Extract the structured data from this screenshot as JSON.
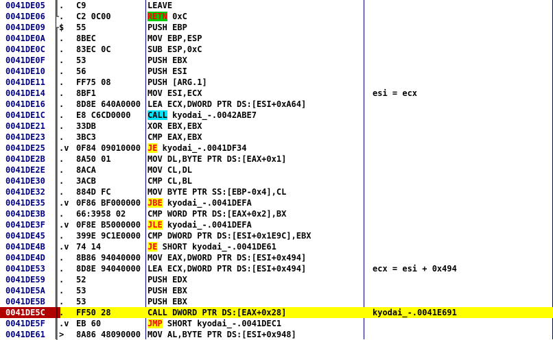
{
  "colors": {
    "address": "#000080",
    "jump_highlight": "#ffff00",
    "jump_text": "#ff0000",
    "call_highlight": "#00e5ff",
    "ret_highlight": "#00cc00",
    "selected_row": "#ffff00",
    "selected_address": "#b00000"
  },
  "rows": [
    {
      "addr": "0041DE05",
      "mark": ".",
      "bracket": "mid",
      "hex": "C9",
      "op": "",
      "opnd": "LEAVE",
      "cmt": ""
    },
    {
      "addr": "0041DE06",
      "mark": ".",
      "bracket": "end",
      "hex": "C2 0C00",
      "op": "RETN",
      "hl": "ret",
      "opnd": " 0xC",
      "cmt": ""
    },
    {
      "addr": "0041DE09",
      "mark": "$",
      "bracket": "start",
      "hex": "55",
      "op": "",
      "opnd": "PUSH EBP",
      "cmt": ""
    },
    {
      "addr": "0041DE0A",
      "mark": ".",
      "bracket": "mid",
      "hex": "8BEC",
      "op": "",
      "opnd": "MOV EBP,ESP",
      "cmt": ""
    },
    {
      "addr": "0041DE0C",
      "mark": ".",
      "bracket": "mid",
      "hex": "83EC 0C",
      "op": "",
      "opnd": "SUB ESP,0xC",
      "cmt": ""
    },
    {
      "addr": "0041DE0F",
      "mark": ".",
      "bracket": "mid",
      "hex": "53",
      "op": "",
      "opnd": "PUSH EBX",
      "cmt": ""
    },
    {
      "addr": "0041DE10",
      "mark": ".",
      "bracket": "mid",
      "hex": "56",
      "op": "",
      "opnd": "PUSH ESI",
      "cmt": ""
    },
    {
      "addr": "0041DE11",
      "mark": ".",
      "bracket": "mid",
      "hex": "FF75 08",
      "op": "",
      "opnd": "PUSH [ARG.1]",
      "cmt": ""
    },
    {
      "addr": "0041DE14",
      "mark": ".",
      "bracket": "mid",
      "hex": "8BF1",
      "op": "",
      "opnd": "MOV ESI,ECX",
      "cmt": "esi = ecx"
    },
    {
      "addr": "0041DE16",
      "mark": ".",
      "bracket": "mid",
      "hex": "8D8E 640A0000",
      "op": "",
      "opnd": "LEA ECX,DWORD PTR DS:[ESI+0xA64]",
      "cmt": ""
    },
    {
      "addr": "0041DE1C",
      "mark": ".",
      "bracket": "mid",
      "hex": "E8 C6CD0000",
      "op": "CALL",
      "hl": "call",
      "opnd": " kyodai_-.0042ABE7",
      "cmt": ""
    },
    {
      "addr": "0041DE21",
      "mark": ".",
      "bracket": "mid",
      "hex": "33DB",
      "op": "",
      "opnd": "XOR EBX,EBX",
      "cmt": ""
    },
    {
      "addr": "0041DE23",
      "mark": ".",
      "bracket": "mid",
      "hex": "3BC3",
      "op": "",
      "opnd": "CMP EAX,EBX",
      "cmt": ""
    },
    {
      "addr": "0041DE25",
      "mark": ".v",
      "bracket": "mid",
      "hex": "0F84 09010000",
      "op": "JE",
      "hl": "jmp",
      "opnd": " kyodai_-.0041DF34",
      "cmt": ""
    },
    {
      "addr": "0041DE2B",
      "mark": ".",
      "bracket": "mid",
      "hex": "8A50 01",
      "op": "",
      "opnd": "MOV DL,BYTE PTR DS:[EAX+0x1]",
      "cmt": ""
    },
    {
      "addr": "0041DE2E",
      "mark": ".",
      "bracket": "mid",
      "hex": "8ACA",
      "op": "",
      "opnd": "MOV CL,DL",
      "cmt": ""
    },
    {
      "addr": "0041DE30",
      "mark": ".",
      "bracket": "mid",
      "hex": "3ACB",
      "op": "",
      "opnd": "CMP CL,BL",
      "cmt": ""
    },
    {
      "addr": "0041DE32",
      "mark": ".",
      "bracket": "mid",
      "hex": "884D FC",
      "op": "",
      "opnd": "MOV BYTE PTR SS:[EBP-0x4],CL",
      "cmt": ""
    },
    {
      "addr": "0041DE35",
      "mark": ".v",
      "bracket": "mid",
      "hex": "0F86 BF000000",
      "op": "JBE",
      "hl": "jmp",
      "opnd": " kyodai_-.0041DEFA",
      "cmt": ""
    },
    {
      "addr": "0041DE3B",
      "mark": ".",
      "bracket": "mid",
      "hex": "66:3958 02",
      "op": "",
      "opnd": "CMP WORD PTR DS:[EAX+0x2],BX",
      "cmt": ""
    },
    {
      "addr": "0041DE3F",
      "mark": ".v",
      "bracket": "mid",
      "hex": "0F8E B5000000",
      "op": "JLE",
      "hl": "jmp",
      "opnd": " kyodai_-.0041DEFA",
      "cmt": ""
    },
    {
      "addr": "0041DE45",
      "mark": ".",
      "bracket": "mid",
      "hex": "399E 9C1E0000",
      "op": "",
      "opnd": "CMP DWORD PTR DS:[ESI+0x1E9C],EBX",
      "cmt": ""
    },
    {
      "addr": "0041DE4B",
      "mark": ".v",
      "bracket": "mid",
      "hex": "74 14",
      "op": "JE",
      "hl": "jmp",
      "opnd": " SHORT kyodai_-.0041DE61",
      "cmt": ""
    },
    {
      "addr": "0041DE4D",
      "mark": ".",
      "bracket": "mid",
      "hex": "8B86 94040000",
      "op": "",
      "opnd": "MOV EAX,DWORD PTR DS:[ESI+0x494]",
      "cmt": ""
    },
    {
      "addr": "0041DE53",
      "mark": ".",
      "bracket": "mid",
      "hex": "8D8E 94040000",
      "op": "",
      "opnd": "LEA ECX,DWORD PTR DS:[ESI+0x494]",
      "cmt": "ecx = esi + 0x494"
    },
    {
      "addr": "0041DE59",
      "mark": ".",
      "bracket": "mid",
      "hex": "52",
      "op": "",
      "opnd": "PUSH EDX",
      "cmt": ""
    },
    {
      "addr": "0041DE5A",
      "mark": ".",
      "bracket": "mid",
      "hex": "53",
      "op": "",
      "opnd": "PUSH EBX",
      "cmt": ""
    },
    {
      "addr": "0041DE5B",
      "mark": ".",
      "bracket": "mid",
      "hex": "53",
      "op": "",
      "opnd": "PUSH EBX",
      "cmt": ""
    },
    {
      "addr": "0041DE5C",
      "mark": ".",
      "bracket": "mid",
      "hex": "FF50 28",
      "op": "CALL",
      "hl": "call",
      "opnd": " DWORD PTR DS:[EAX+0x28]",
      "cmt": "kyodai_-.0041E691",
      "selected": true
    },
    {
      "addr": "0041DE5F",
      "mark": ".v",
      "bracket": "mid",
      "hex": "EB 60",
      "op": "JMP",
      "hl": "jmp",
      "opnd": " SHORT kyodai_-.0041DEC1",
      "cmt": ""
    },
    {
      "addr": "0041DE61",
      "mark": ">",
      "bracket": "mid",
      "hex": "8A86 48090000",
      "op": "",
      "opnd": "MOV AL,BYTE PTR DS:[ESI+0x948]",
      "cmt": ""
    }
  ]
}
